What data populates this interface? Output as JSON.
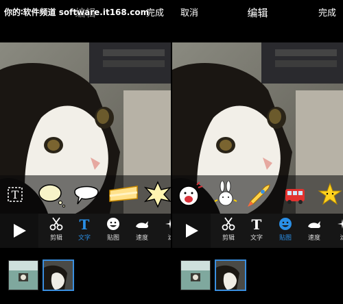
{
  "watermark": "你的∶软件频道 software.it168.com",
  "left_screen": {
    "header": {
      "cancel": "",
      "title": "编辑",
      "done": "完成"
    },
    "tools": [
      {
        "label": "剪辑",
        "icon": "scissors-icon"
      },
      {
        "label": "文字",
        "icon": "text-icon",
        "active": true
      },
      {
        "label": "贴图",
        "icon": "sticker-smiley-icon"
      },
      {
        "label": "速度",
        "icon": "speed-rabbit-icon"
      },
      {
        "label": "滤",
        "icon": "filter-sparkle-icon"
      }
    ],
    "text_styles": [
      "text-frame-icon",
      "oval-bubble-icon",
      "speech-bubble-icon",
      "banner-label-icon",
      "burst-star-icon"
    ]
  },
  "right_screen": {
    "header": {
      "cancel": "取消",
      "title": "编辑",
      "done": "完成"
    },
    "tools": [
      {
        "label": "剪辑",
        "icon": "scissors-icon"
      },
      {
        "label": "文字",
        "icon": "text-icon"
      },
      {
        "label": "贴图",
        "icon": "sticker-smiley-icon",
        "active": true
      },
      {
        "label": "速度",
        "icon": "speed-rabbit-icon"
      },
      {
        "label": "滤",
        "icon": "filter-sparkle-icon"
      }
    ],
    "stickers": [
      "shouting-face-sticker",
      "rabbit-sticker",
      "rocket-sticker",
      "bus-sticker",
      "star-sticker"
    ]
  },
  "colors": {
    "active": "#2a8fe6",
    "toolbar": "#161616",
    "background": "#000000"
  }
}
